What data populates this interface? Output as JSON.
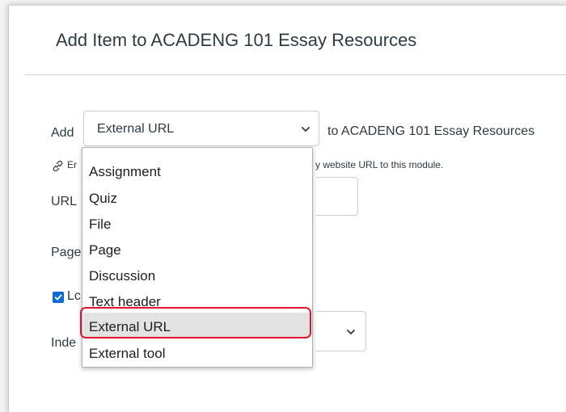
{
  "dialog": {
    "title": "Add Item to ACADENG 101 Essay Resources"
  },
  "form": {
    "add_label": "Add",
    "type_select": {
      "value": "External URL",
      "caret_icon": "chevron-down-icon"
    },
    "to_label": "to ACADENG 101 Essay Resources",
    "hint": {
      "icon": "link-icon",
      "left_fragment": "Er",
      "right_fragment": "y website URL to this module."
    },
    "url_label": "URL",
    "page_label": "Page",
    "new_tab": {
      "checked": true,
      "label_fragment": "Lc"
    },
    "indent_label": "Inde",
    "indent_caret_icon": "chevron-down-icon"
  },
  "dropdown": {
    "options": [
      {
        "label": "Assignment"
      },
      {
        "label": "Quiz"
      },
      {
        "label": "File"
      },
      {
        "label": "Page"
      },
      {
        "label": "Discussion"
      },
      {
        "label": "Text header"
      },
      {
        "label": "External URL",
        "highlighted": true
      },
      {
        "label": "External tool"
      }
    ]
  },
  "colors": {
    "text": "#2d3b45",
    "accent_blue": "#0a6bd6",
    "highlight_red": "#e5132b",
    "option_hover": "#e3e3e3"
  }
}
